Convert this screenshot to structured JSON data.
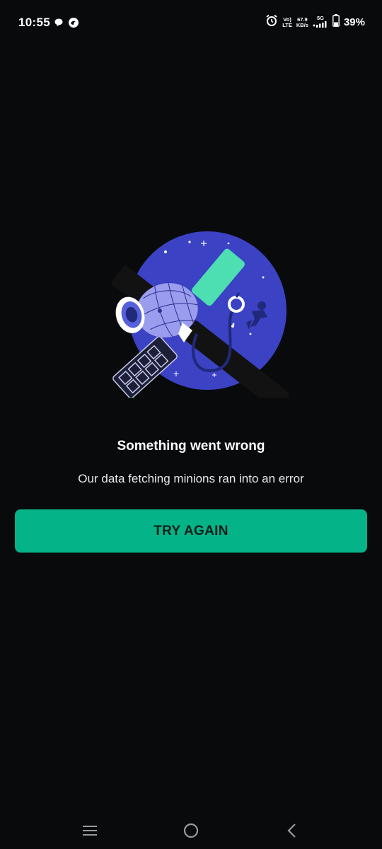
{
  "status_bar": {
    "time": "10:55",
    "volte_top": "Vo)",
    "volte_bottom": "LTE",
    "speed_value": "67.9",
    "speed_unit": "KB/s",
    "network": "5G",
    "battery_percent": "39%",
    "battery_level": 0.39,
    "left_icons": [
      "chat-bubble-icon",
      "sync-circle-icon"
    ],
    "right_icons": [
      "alarm-icon",
      "signal-icon",
      "battery-icon"
    ]
  },
  "error": {
    "title": "Something went wrong",
    "subtitle": "Our data fetching minions ran into an error",
    "retry_label": "TRY AGAIN"
  },
  "nav": {
    "items": [
      "menu-icon",
      "home-circle-icon",
      "back-chevron-icon"
    ]
  },
  "colors": {
    "background": "#090a0c",
    "accent": "#04b388",
    "planet": "#3b42c4",
    "panel": "#4ddfb1"
  }
}
